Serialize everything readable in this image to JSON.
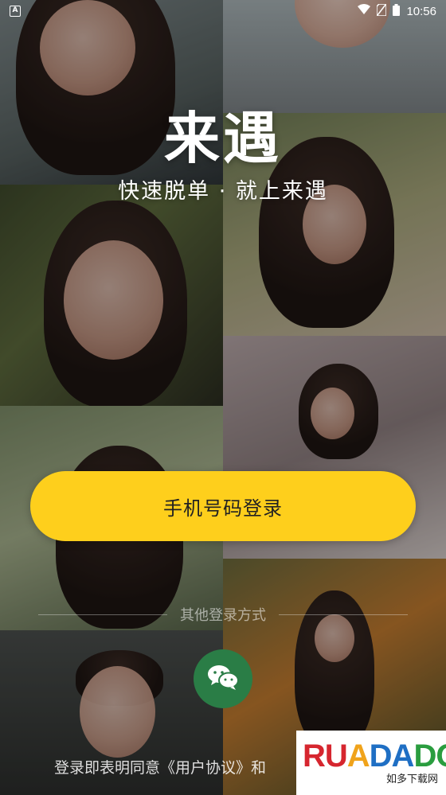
{
  "status_bar": {
    "app_badge": "A",
    "time": "10:56",
    "icons": [
      "wifi-icon",
      "no-sim-icon",
      "battery-icon"
    ]
  },
  "brand": {
    "title": "来遇",
    "slogan": "快速脱单 · 就上来遇"
  },
  "login": {
    "phone_button_label": "手机号码登录",
    "other_methods_label": "其他登录方式",
    "wechat_icon": "wechat-icon"
  },
  "agreement": {
    "text": "登录即表明同意《用户协议》和"
  },
  "watermark": {
    "logo_part1": "RU",
    "logo_part2": "A",
    "logo_part3": "DA",
    "logo_part4": "DO",
    "subtitle": "如多下载网"
  },
  "colors": {
    "accent_button": "#fecf1c",
    "wechat_green": "#2a7d46"
  }
}
